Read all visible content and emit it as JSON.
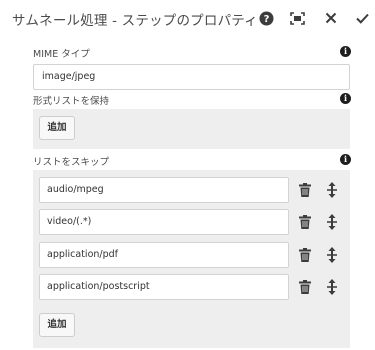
{
  "dialog": {
    "title": "サムネール処理 - ステップのプロパティ",
    "help_icon": "help-circle-icon",
    "fullscreen_icon": "fullscreen-icon",
    "close_icon": "close-icon",
    "done_icon": "checkmark-icon"
  },
  "fields": {
    "mime_label": "MIME タイプ",
    "mime_value": "image/jpeg",
    "keep_label": "形式リストを保持",
    "keep_add": "追加",
    "skip_label": "リストをスキップ",
    "skip_items": [
      {
        "value": "audio/mpeg"
      },
      {
        "value": "video/(.*)"
      },
      {
        "value": "application/pdf"
      },
      {
        "value": "application/postscript"
      }
    ],
    "skip_add": "追加",
    "info_glyph": "i"
  }
}
